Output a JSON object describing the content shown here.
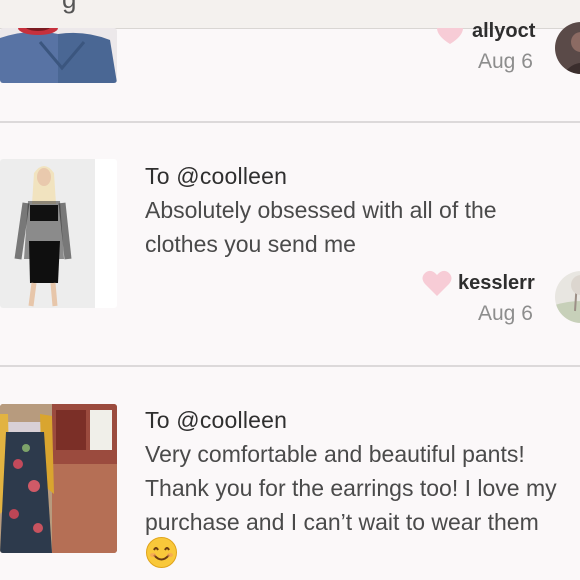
{
  "header": {
    "title_fragment": "g"
  },
  "reviews": [
    {
      "to": "",
      "message": [],
      "username": "allyoct",
      "date": "Aug 6"
    },
    {
      "to": "To @coolleen",
      "message": [
        "Absolutely obsessed with all of the",
        "clothes you send me"
      ],
      "username": "kesslerr",
      "date": "Aug 6"
    },
    {
      "to": "To @coolleen",
      "message": [
        "Very comfortable and beautiful pants!",
        "Thank you for the earrings too! I love my",
        "purchase and I can’t wait to wear them"
      ],
      "emoji": "smiling-face-emoji"
    }
  ],
  "icons": {
    "like": "heart-icon"
  },
  "colors": {
    "heart": "#f7ccd6",
    "background": "#fbf8f9",
    "divider": "#dcd9da"
  }
}
